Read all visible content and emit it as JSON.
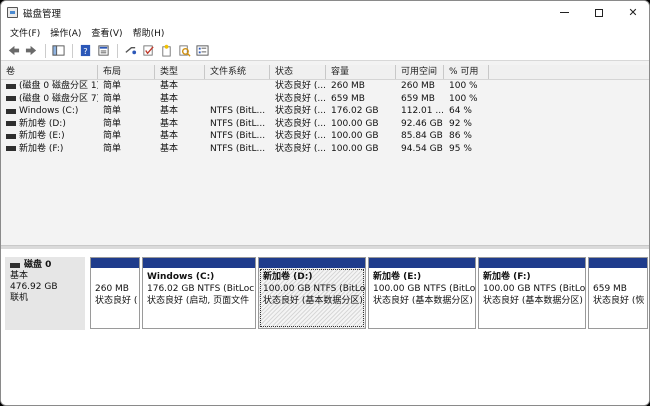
{
  "window": {
    "title": "磁盘管理"
  },
  "menu": [
    "文件(F)",
    "操作(A)",
    "查看(V)",
    "帮助(H)"
  ],
  "toolbar": {
    "icons": [
      "back-arrow-icon",
      "forward-arrow-icon",
      "console-tree-icon",
      "help-icon",
      "properties-icon",
      "connect-icon",
      "check-icon",
      "new-item-icon",
      "search-icon",
      "volume-list-icon"
    ]
  },
  "volumes": {
    "columns": [
      "卷",
      "布局",
      "类型",
      "文件系统",
      "状态",
      "容量",
      "可用空间",
      "% 可用"
    ],
    "rows": [
      [
        "(磁盘 0 磁盘分区 1)",
        "简单",
        "基本",
        "",
        "状态良好 (...",
        "260 MB",
        "260 MB",
        "100 %"
      ],
      [
        "(磁盘 0 磁盘分区 7)",
        "简单",
        "基本",
        "",
        "状态良好 (...",
        "659 MB",
        "659 MB",
        "100 %"
      ],
      [
        "Windows (C:)",
        "简单",
        "基本",
        "NTFS (BitL...",
        "状态良好 (...",
        "176.02 GB",
        "112.01 ...",
        "64 %"
      ],
      [
        "新加卷 (D:)",
        "简单",
        "基本",
        "NTFS (BitL...",
        "状态良好 (...",
        "100.00 GB",
        "92.46 GB",
        "92 %"
      ],
      [
        "新加卷 (E:)",
        "简单",
        "基本",
        "NTFS (BitL...",
        "状态良好 (...",
        "100.00 GB",
        "85.84 GB",
        "86 %"
      ],
      [
        "新加卷 (F:)",
        "简单",
        "基本",
        "NTFS (BitL...",
        "状态良好 (...",
        "100.00 GB",
        "94.54 GB",
        "95 %"
      ]
    ]
  },
  "disk": {
    "name": "磁盘 0",
    "type": "基本",
    "size": "476.92 GB",
    "status": "联机"
  },
  "partitions": [
    {
      "name": "",
      "size": "260 MB",
      "status": "状态良好 ("
    },
    {
      "name": "Windows (C:)",
      "size": "176.02 GB NTFS (BitLocke",
      "status": "状态良好 (启动, 页面文件"
    },
    {
      "name": "新加卷 (D:)",
      "size": "100.00 GB NTFS (BitLocl",
      "status": "状态良好 (基本数据分区)"
    },
    {
      "name": "新加卷 (E:)",
      "size": "100.00 GB NTFS (BitLocl",
      "status": "状态良好 (基本数据分区)"
    },
    {
      "name": "新加卷 (F:)",
      "size": "100.00 GB NTFS (BitLocl",
      "status": "状态良好 (基本数据分区)"
    },
    {
      "name": "",
      "size": "659 MB",
      "status": "状态良好 (恢"
    }
  ],
  "colors": {
    "partition_band": "#1f3c8c",
    "disk_label_bg": "#e6e6e6"
  }
}
